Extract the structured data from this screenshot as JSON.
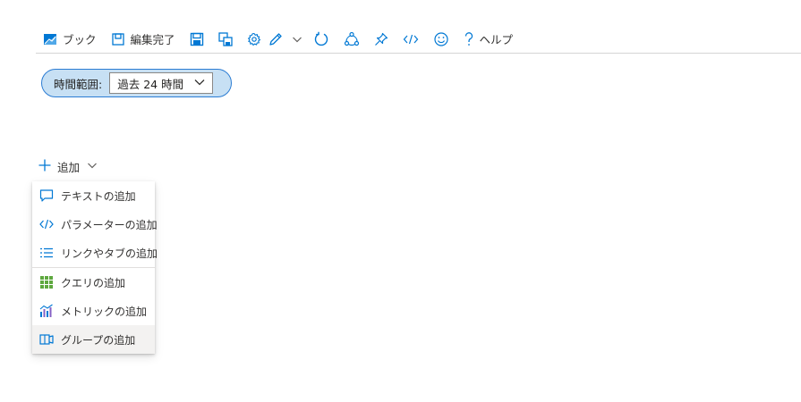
{
  "toolbar": {
    "book_label": "ブック",
    "edit_done_label": "編集完了",
    "help_label": "ヘルプ",
    "icons": [
      "workbook-icon",
      "edit-done-icon",
      "save-icon",
      "save-as-icon",
      "settings-icon",
      "pencil-icon",
      "chevron-down-icon",
      "refresh-icon",
      "share-icon",
      "pin-icon",
      "code-icon",
      "smiley-icon",
      "help-icon"
    ]
  },
  "time_range": {
    "label": "時間範囲:",
    "value": "過去 24 時間"
  },
  "add": {
    "label": "追加"
  },
  "menu": {
    "items": [
      {
        "label": "テキストの追加",
        "icon": "comment-icon"
      },
      {
        "label": "パラメーターの追加",
        "icon": "code-icon"
      },
      {
        "label": "リンクやタブの追加",
        "icon": "list-icon"
      },
      {
        "label": "クエリの追加",
        "icon": "grid-icon"
      },
      {
        "label": "メトリックの追加",
        "icon": "metric-chart-icon"
      },
      {
        "label": "グループの追加",
        "icon": "group-icon"
      }
    ]
  },
  "colors": {
    "accent": "#0078d4",
    "pill_bg": "#c7e0f4",
    "pill_border": "#2b7cd3",
    "query_green": "#5ea83f",
    "selected_bg": "#f3f2f1"
  }
}
